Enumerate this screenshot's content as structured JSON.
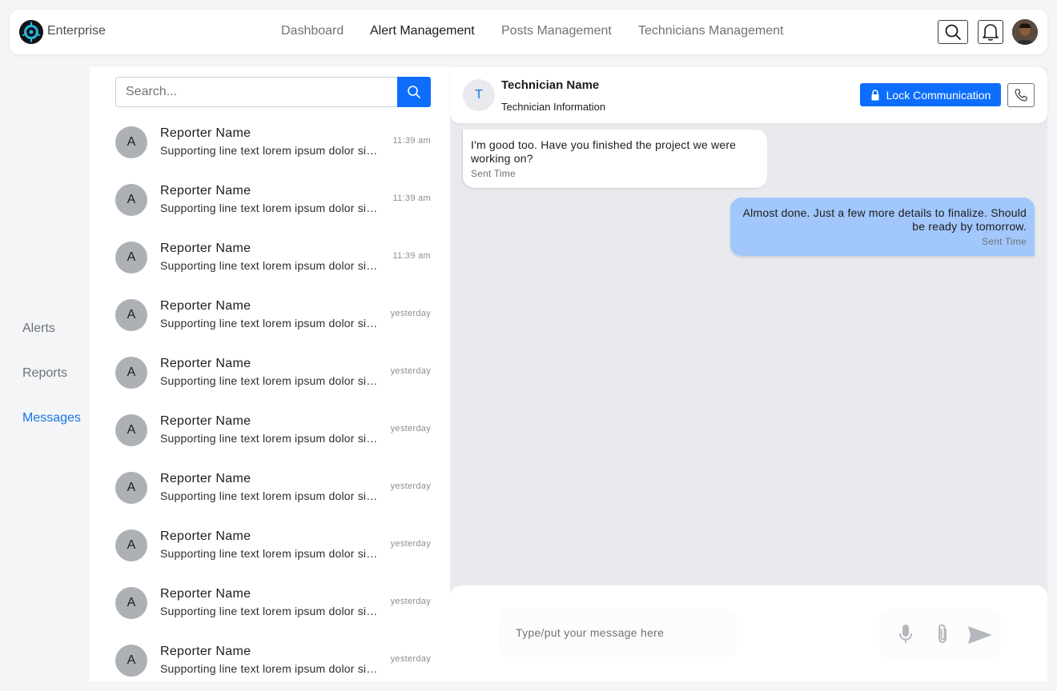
{
  "header": {
    "brand": "Enterprise",
    "nav": [
      {
        "label": "Dashboard"
      },
      {
        "label": "Alert Management"
      },
      {
        "label": "Posts Management"
      },
      {
        "label": "Technicians Management"
      }
    ],
    "active_nav": "Alert Management",
    "icons": [
      "search-icon",
      "bell-icon",
      "user-avatar"
    ]
  },
  "rail": {
    "items": [
      {
        "label": "Alerts"
      },
      {
        "label": "Reports"
      },
      {
        "label": "Messages"
      }
    ],
    "active": "Messages"
  },
  "search": {
    "placeholder": "Search..."
  },
  "conversations": [
    {
      "initial": "A",
      "name": "Reporter Name",
      "preview": "Supporting line text lorem ipsum dolor sit amet",
      "time": "11:39 am"
    },
    {
      "initial": "A",
      "name": "Reporter Name",
      "preview": "Supporting line text lorem ipsum dolor sit amet",
      "time": "11:39 am"
    },
    {
      "initial": "A",
      "name": "Reporter Name",
      "preview": "Supporting line text lorem ipsum dolor sit amet",
      "time": "11:39 am"
    },
    {
      "initial": "A",
      "name": "Reporter Name",
      "preview": "Supporting line text lorem ipsum dolor sit amet",
      "time": "yesterday"
    },
    {
      "initial": "A",
      "name": "Reporter Name",
      "preview": "Supporting line text lorem ipsum dolor sit amet",
      "time": "yesterday"
    },
    {
      "initial": "A",
      "name": "Reporter Name",
      "preview": "Supporting line text lorem ipsum dolor sit amet",
      "time": "yesterday"
    },
    {
      "initial": "A",
      "name": "Reporter Name",
      "preview": "Supporting line text lorem ipsum dolor sit amet",
      "time": "yesterday"
    },
    {
      "initial": "A",
      "name": "Reporter Name",
      "preview": "Supporting line text lorem ipsum dolor sit amet",
      "time": "yesterday"
    },
    {
      "initial": "A",
      "name": "Reporter Name",
      "preview": "Supporting line text lorem ipsum dolor sit amet",
      "time": "yesterday"
    },
    {
      "initial": "A",
      "name": "Reporter Name",
      "preview": "Supporting line text lorem ipsum dolor sit amet",
      "time": "yesterday"
    }
  ],
  "chat": {
    "initial": "T",
    "name": "Technician Name",
    "info": "Technician Information",
    "lock_label": "Lock Communication",
    "messages": [
      {
        "direction": "in",
        "text": "I'm good too. Have you finished the project we were working on?",
        "meta": "Sent Time"
      },
      {
        "direction": "out",
        "text": "Almost done. Just a few more details to finalize. Should be ready by tomorrow.",
        "meta": "Sent Time"
      }
    ],
    "composer_placeholder": "Type/put your message here"
  },
  "colors": {
    "accent": "#0d6efd",
    "active_link": "#1a73e8",
    "outgoing_bubble": "#a2c7fc",
    "chat_bg": "#e8eaed"
  }
}
